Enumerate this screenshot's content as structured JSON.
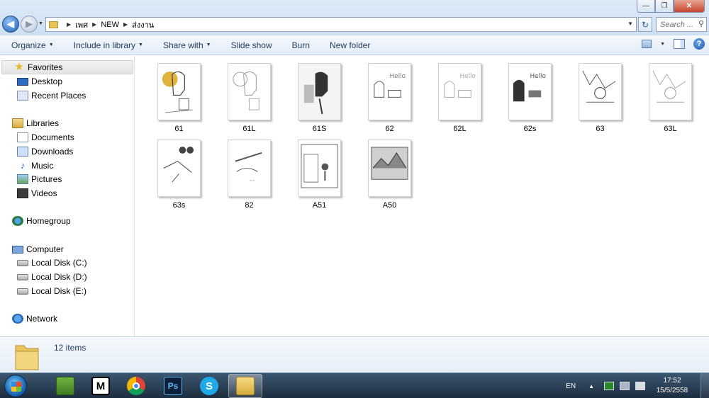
{
  "window": {
    "controls": {
      "minimize": "—",
      "maximize": "❐",
      "close": "✕"
    }
  },
  "address_bar": {
    "breadcrumb": [
      "เพศ",
      "NEW",
      "ส่งงาน"
    ],
    "search_placeholder": "Search ..."
  },
  "toolbar": {
    "organize": "Organize",
    "include_in_library": "Include in library",
    "share_with": "Share with",
    "slide_show": "Slide show",
    "burn": "Burn",
    "new_folder": "New folder"
  },
  "sidebar": {
    "favorites": {
      "label": "Favorites",
      "items": [
        "Desktop",
        "Recent Places"
      ]
    },
    "libraries": {
      "label": "Libraries",
      "items": [
        "Documents",
        "Downloads",
        "Music",
        "Pictures",
        "Videos"
      ]
    },
    "homegroup": {
      "label": "Homegroup"
    },
    "computer": {
      "label": "Computer",
      "items": [
        "Local Disk (C:)",
        "Local Disk (D:)",
        "Local Disk (E:)"
      ]
    },
    "network": {
      "label": "Network"
    }
  },
  "files": [
    {
      "name": "61"
    },
    {
      "name": "61L"
    },
    {
      "name": "61S"
    },
    {
      "name": "62"
    },
    {
      "name": "62L"
    },
    {
      "name": "62s"
    },
    {
      "name": "63"
    },
    {
      "name": "63L"
    },
    {
      "name": "63s"
    },
    {
      "name": "82"
    },
    {
      "name": "A51"
    },
    {
      "name": "A50"
    }
  ],
  "details": {
    "item_count": "12 items"
  },
  "taskbar": {
    "apps": [
      {
        "icon": "minecraft-icon",
        "symbol": ""
      },
      {
        "icon": "m-app-icon",
        "symbol": "M"
      },
      {
        "icon": "chrome-icon",
        "symbol": ""
      },
      {
        "icon": "photoshop-icon",
        "symbol": "Ps"
      },
      {
        "icon": "skype-icon",
        "symbol": "S"
      },
      {
        "icon": "explorer-icon",
        "symbol": ""
      }
    ],
    "language": "EN",
    "time": "17:52",
    "date": "15/5/2558"
  },
  "colors": {
    "toolbar_text": "#1e395b",
    "taskbar_bg": "#1d2d3f",
    "folder_yellow": "#e8c35a"
  }
}
